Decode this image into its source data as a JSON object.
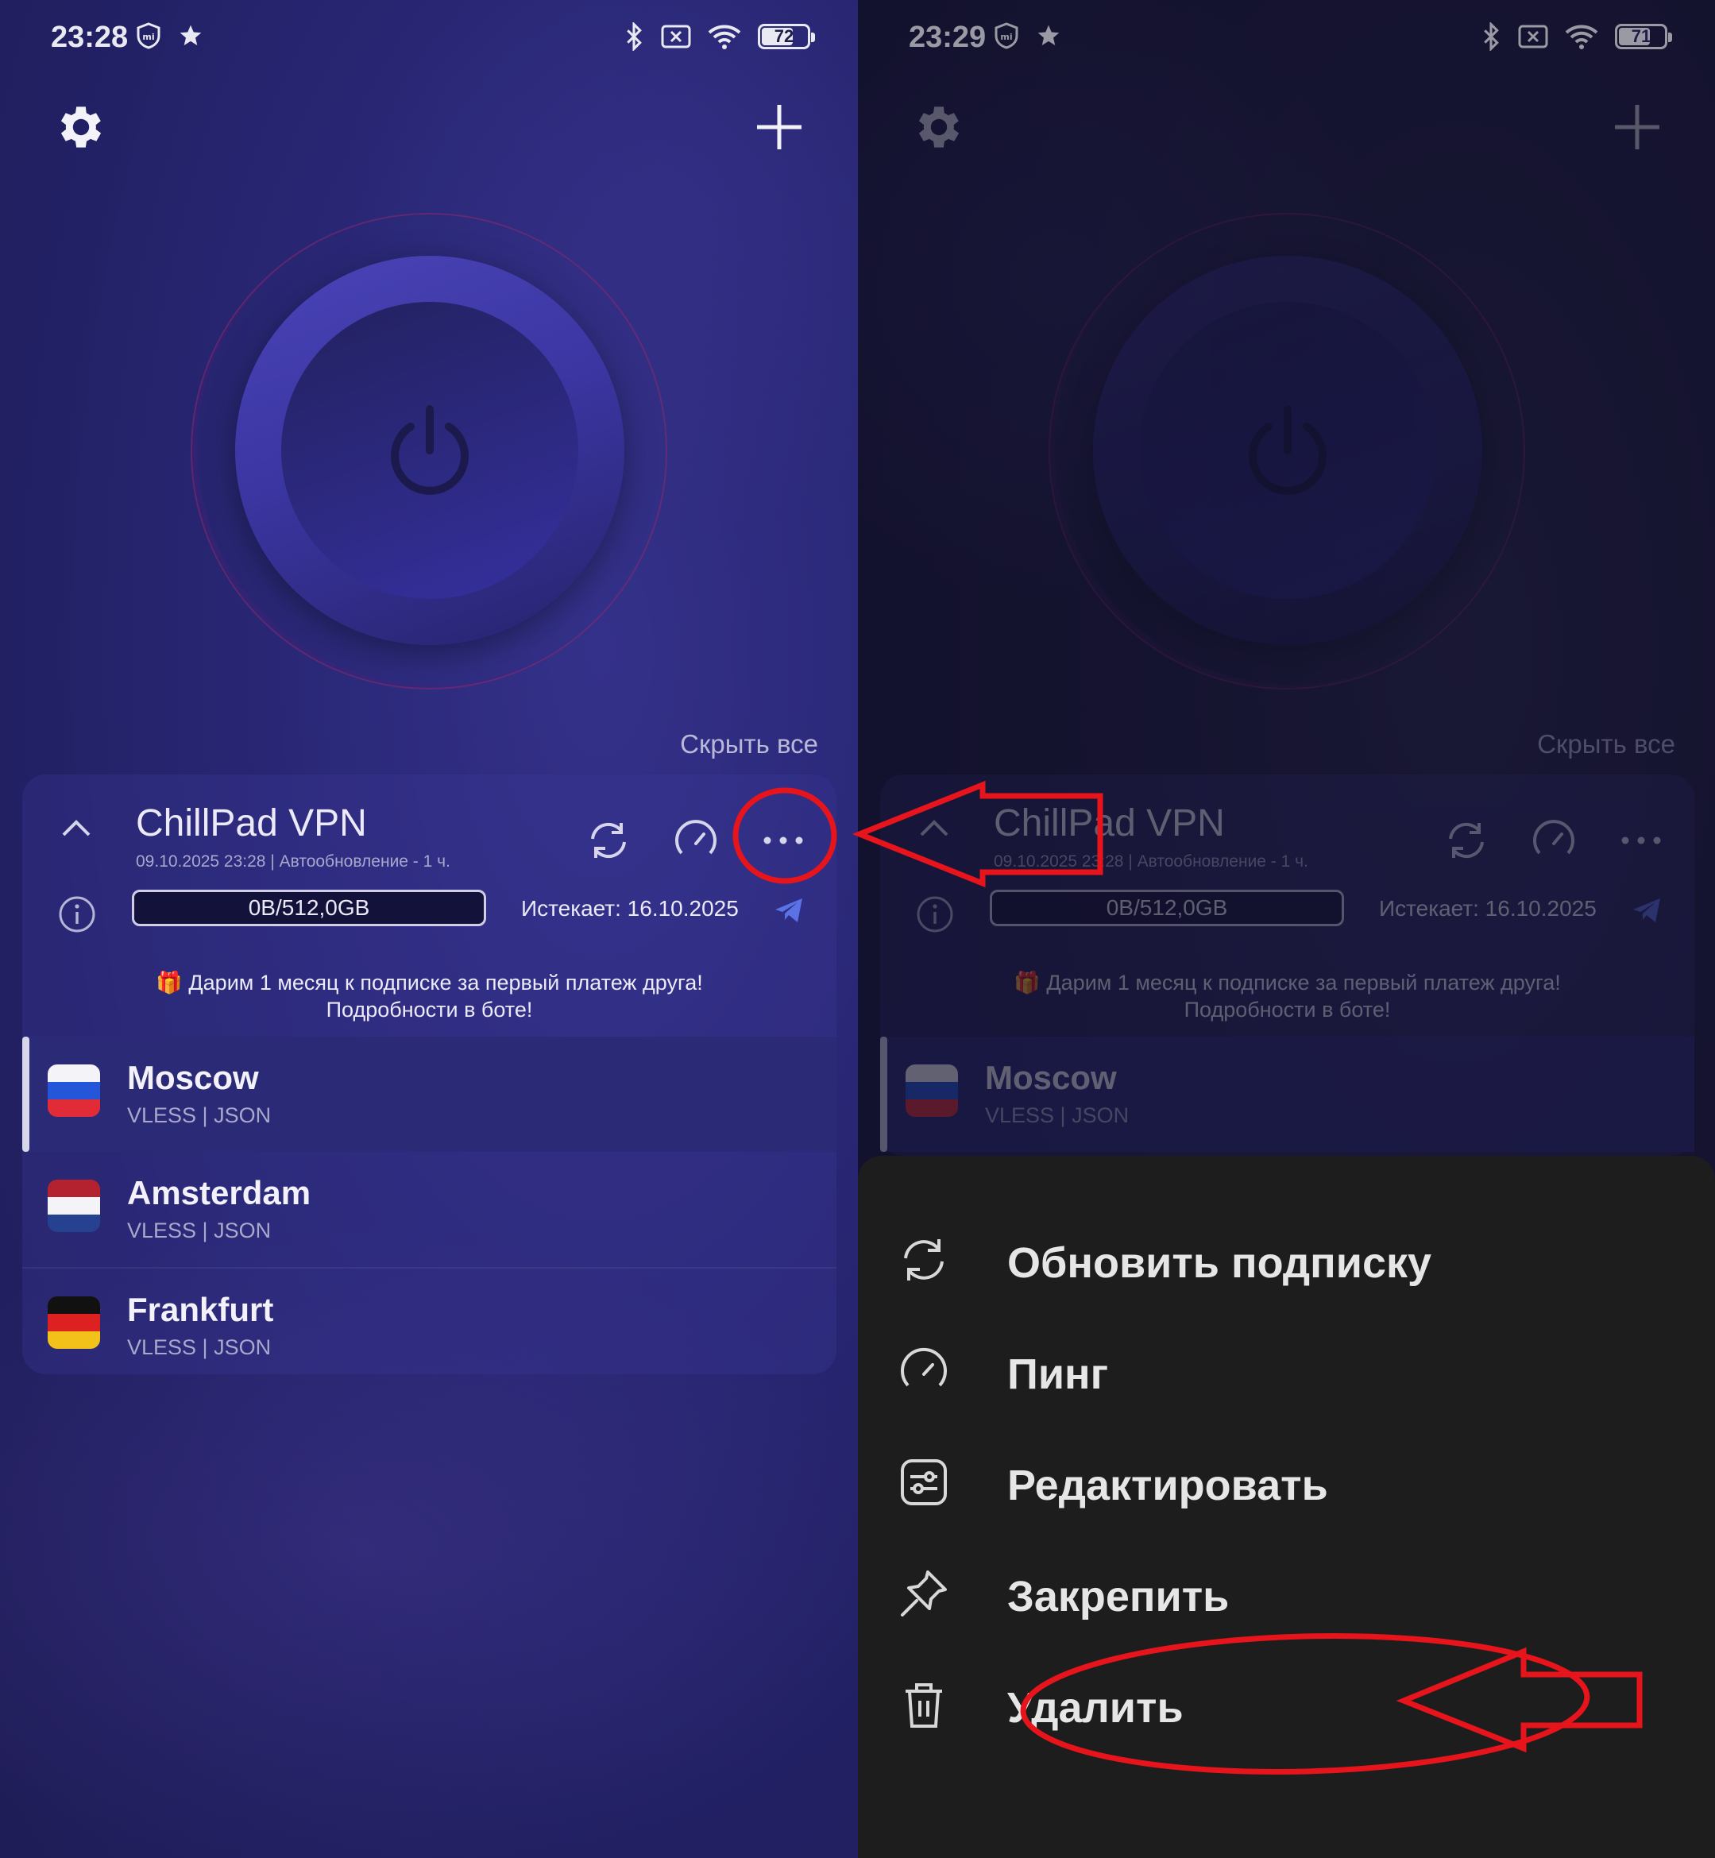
{
  "left": {
    "status": {
      "time": "23:28",
      "battery": "72",
      "battery_level": 0.72
    },
    "hide_all": "Скрыть все",
    "subscription": {
      "title": "ChillPad VPN",
      "meta": "09.10.2025 23:28 | Автообновление - 1 ч.",
      "traffic": "0B/512,0GB",
      "expires": "Истекает: 16.10.2025",
      "promo_line1": "🎁 Дарим 1 месяц к подписке за первый платеж друга!",
      "promo_line2": "Подробности в боте!"
    },
    "servers": [
      {
        "name": "Moscow",
        "meta": "VLESS | JSON",
        "flag": "ru",
        "active": true
      },
      {
        "name": "Amsterdam",
        "meta": "VLESS | JSON",
        "flag": "nl",
        "active": false
      },
      {
        "name": "Frankfurt",
        "meta": "VLESS | JSON",
        "flag": "de",
        "active": false
      }
    ]
  },
  "right": {
    "status": {
      "time": "23:29",
      "battery": "71",
      "battery_level": 0.71
    },
    "hide_all": "Скрыть все",
    "subscription": {
      "title": "ChillPad VPN",
      "meta": "09.10.2025 23:28 | Автообновление - 1 ч.",
      "traffic": "0B/512,0GB",
      "expires": "Истекает: 16.10.2025",
      "promo_line1": "🎁 Дарим 1 месяц к подписке за первый платеж друга!",
      "promo_line2": "Подробности в боте!"
    },
    "servers": [
      {
        "name": "Moscow",
        "meta": "VLESS | JSON",
        "flag": "ru",
        "active": true
      }
    ],
    "menu": [
      {
        "label": "Обновить подписку",
        "icon": "refresh-icon"
      },
      {
        "label": "Пинг",
        "icon": "speedometer-icon"
      },
      {
        "label": "Редактировать",
        "icon": "sliders-icon"
      },
      {
        "label": "Закрепить",
        "icon": "pin-icon"
      },
      {
        "label": "Удалить",
        "icon": "trash-icon"
      }
    ]
  },
  "colors": {
    "accent": "#4a44b8",
    "annotation": "#e8141c",
    "sheet": "#1d1d1d",
    "telegram": "#5a72e6"
  }
}
